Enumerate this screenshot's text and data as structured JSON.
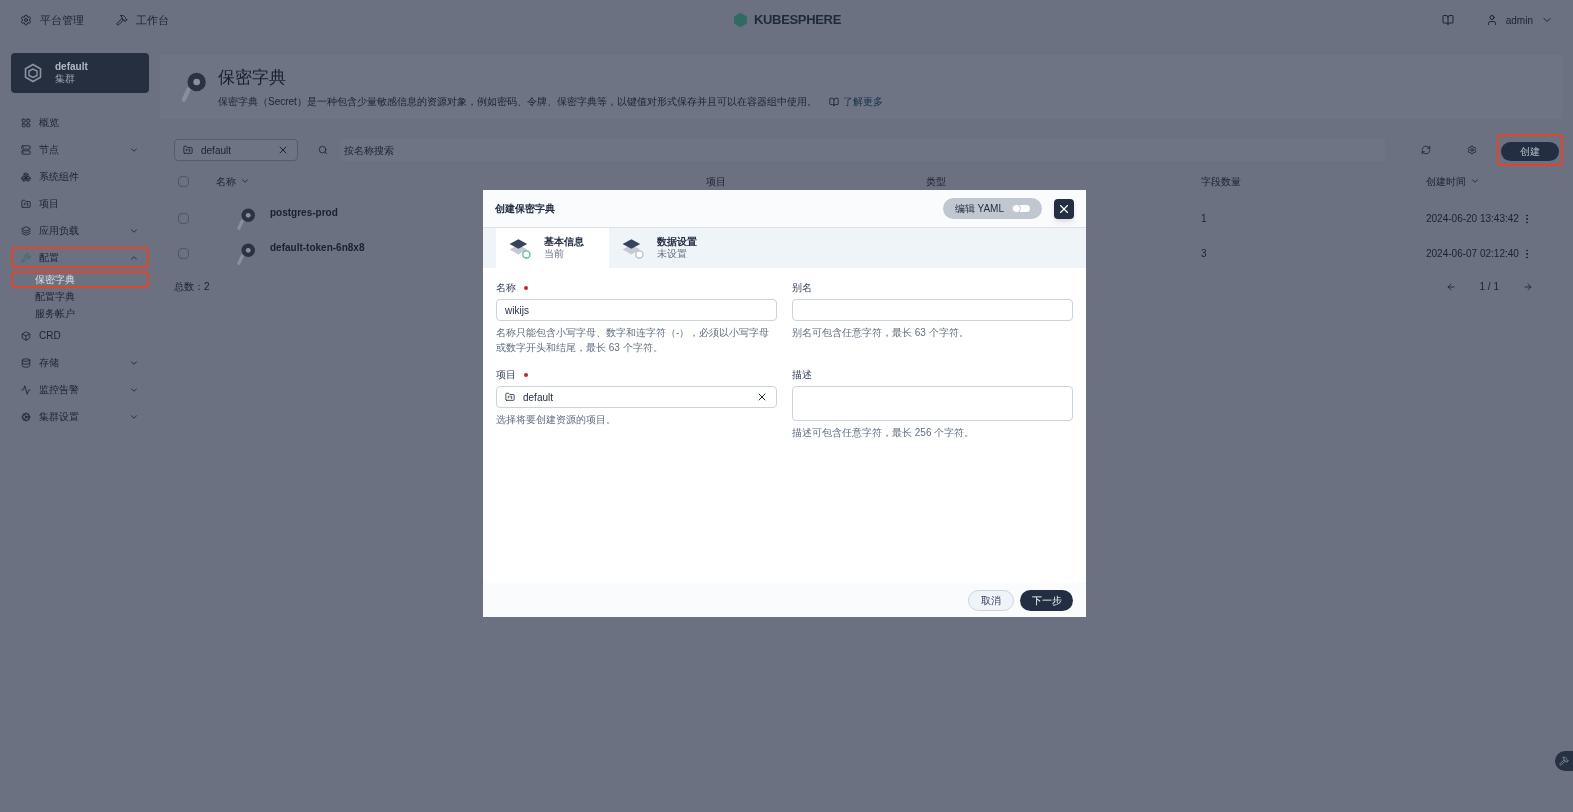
{
  "top_bar": {
    "nav": [
      {
        "kind": "platform",
        "label": "平台管理"
      },
      {
        "kind": "workbench",
        "label": "工作台"
      }
    ],
    "logo": "KUBESPHERE",
    "user": "admin"
  },
  "cluster": {
    "name": "default",
    "type": "集群"
  },
  "sidebar": {
    "items": [
      {
        "kind": "overview",
        "label": "概览",
        "expandable": false,
        "highlighted": false
      },
      {
        "kind": "nodes",
        "label": "节点",
        "expandable": true,
        "expanded": false,
        "highlighted": false
      },
      {
        "kind": "components",
        "label": "系统组件",
        "expandable": false,
        "highlighted": false
      },
      {
        "kind": "projects",
        "label": "项目",
        "expandable": false,
        "highlighted": false
      },
      {
        "kind": "workloads",
        "label": "应用负载",
        "expandable": true,
        "expanded": false,
        "highlighted": false
      },
      {
        "kind": "config",
        "label": "配置",
        "expandable": true,
        "expanded": true,
        "highlighted": true,
        "children": [
          {
            "label": "保密字典",
            "selected": true,
            "highlighted": true
          },
          {
            "label": "配置字典",
            "selected": false,
            "highlighted": false
          },
          {
            "label": "服务帐户",
            "selected": false,
            "highlighted": false
          }
        ]
      },
      {
        "kind": "crd",
        "label": "CRD",
        "expandable": false,
        "highlighted": false
      },
      {
        "kind": "storage",
        "label": "存储",
        "expandable": true,
        "expanded": false,
        "highlighted": false
      },
      {
        "kind": "monitoring",
        "label": "监控告警",
        "expandable": true,
        "expanded": false,
        "highlighted": false
      },
      {
        "kind": "settings",
        "label": "集群设置",
        "expandable": true,
        "expanded": false,
        "highlighted": false
      }
    ]
  },
  "page_header": {
    "title": "保密字典",
    "description": "保密字典（Secret）是一种包含少量敏感信息的资源对象，例如密码、令牌、保密字典等，以键值对形式保存并且可以在容器组中使用。",
    "link": "了解更多"
  },
  "toolbar": {
    "project_filter": "default",
    "search": {
      "placeholder": "按名称搜索"
    },
    "create_button": {
      "label": "创建",
      "highlighted": true
    }
  },
  "table": {
    "columns": [
      "名称",
      "项目",
      "类型",
      "字段数量",
      "创建时间"
    ],
    "all_checked": false,
    "rows": [
      {
        "name": "postgres-prod",
        "fields": "1",
        "created": "2024-06-20 13:43:42",
        "checked": false
      },
      {
        "name": "default-token-6n8x8",
        "fields": "3",
        "created": "2024-06-07 02:12:40",
        "checked": false
      }
    ],
    "total": "总数：2",
    "page": "1 / 1"
  },
  "dialog": {
    "title": "创建保密字典",
    "yaml_toggle": {
      "label": "编辑 YAML",
      "on": false
    },
    "steps": [
      {
        "title": "基本信息",
        "status": "当前",
        "selected": true
      },
      {
        "title": "数据设置",
        "status": "未设置",
        "selected": false
      }
    ],
    "fields": [
      {
        "kind": "text",
        "label": "名称",
        "required": true,
        "value": "wikijs",
        "hint": "名称只能包含小写字母、数字和连字符（-），必须以小写字母或数字开头和结尾，最长 63 个字符。"
      },
      {
        "kind": "text",
        "label": "别名",
        "required": false,
        "hint": "别名可包含任意字符，最长 63 个字符。"
      },
      {
        "kind": "select",
        "label": "项目",
        "required": true,
        "value": "default",
        "hint": "选择将要创建资源的项目。"
      },
      {
        "kind": "textarea",
        "label": "描述",
        "required": false,
        "hint": "描述可包含任意字符，最长 256 个字符。"
      }
    ],
    "buttons": {
      "cancel": "取消",
      "next": "下一步"
    }
  }
}
